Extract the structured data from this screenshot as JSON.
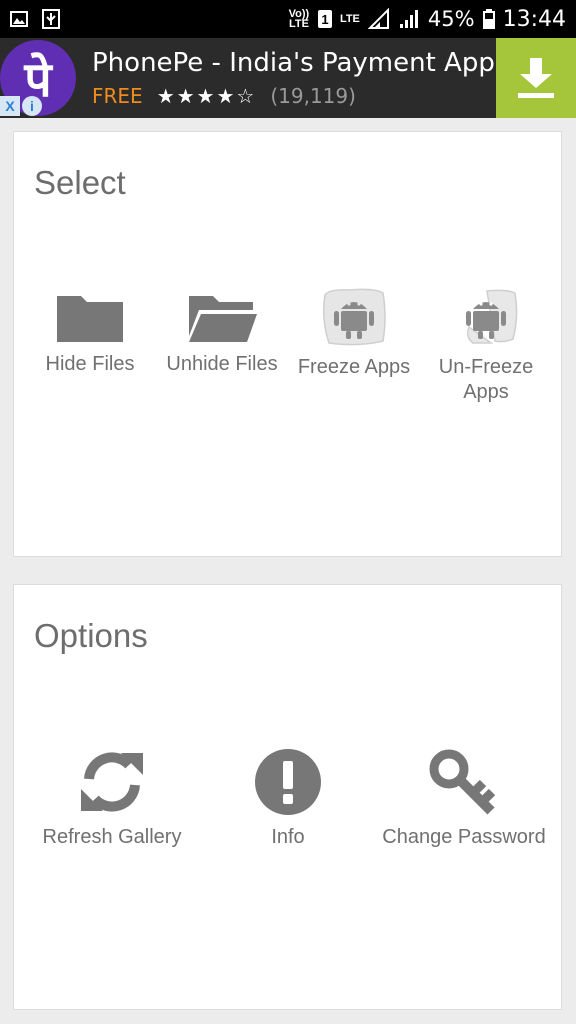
{
  "status_bar": {
    "volte": "Vo)) LTE",
    "sim": "1",
    "lte": "LTE",
    "battery_percent": "45%",
    "time": "13:44"
  },
  "ad": {
    "logo_text": "पे",
    "title": "PhonePe - India's Payment App",
    "price": "FREE",
    "stars": "★★★★☆",
    "rating_count": "(19,119)",
    "close_glyph": "X",
    "info_glyph": "i",
    "colors": {
      "logo_bg": "#5f2eb3",
      "free": "#f08c1c",
      "download_bg": "#a5c63b"
    }
  },
  "select_card": {
    "title": "Select",
    "items": [
      {
        "label": "Hide Files",
        "icon": "folder-closed-icon"
      },
      {
        "label": "Unhide Files",
        "icon": "folder-open-icon"
      },
      {
        "label": "Freeze Apps",
        "icon": "frozen-android-icon"
      },
      {
        "label": "Un-Freeze Apps",
        "icon": "unfrozen-android-icon"
      }
    ]
  },
  "options_card": {
    "title": "Options",
    "items": [
      {
        "label": "Refresh Gallery",
        "icon": "refresh-icon"
      },
      {
        "label": "Info",
        "icon": "info-exclamation-icon"
      },
      {
        "label": "Change Password",
        "icon": "key-icon"
      }
    ]
  },
  "colors": {
    "icon_gray": "#777777",
    "text_gray": "#707070",
    "background": "#ececec"
  }
}
